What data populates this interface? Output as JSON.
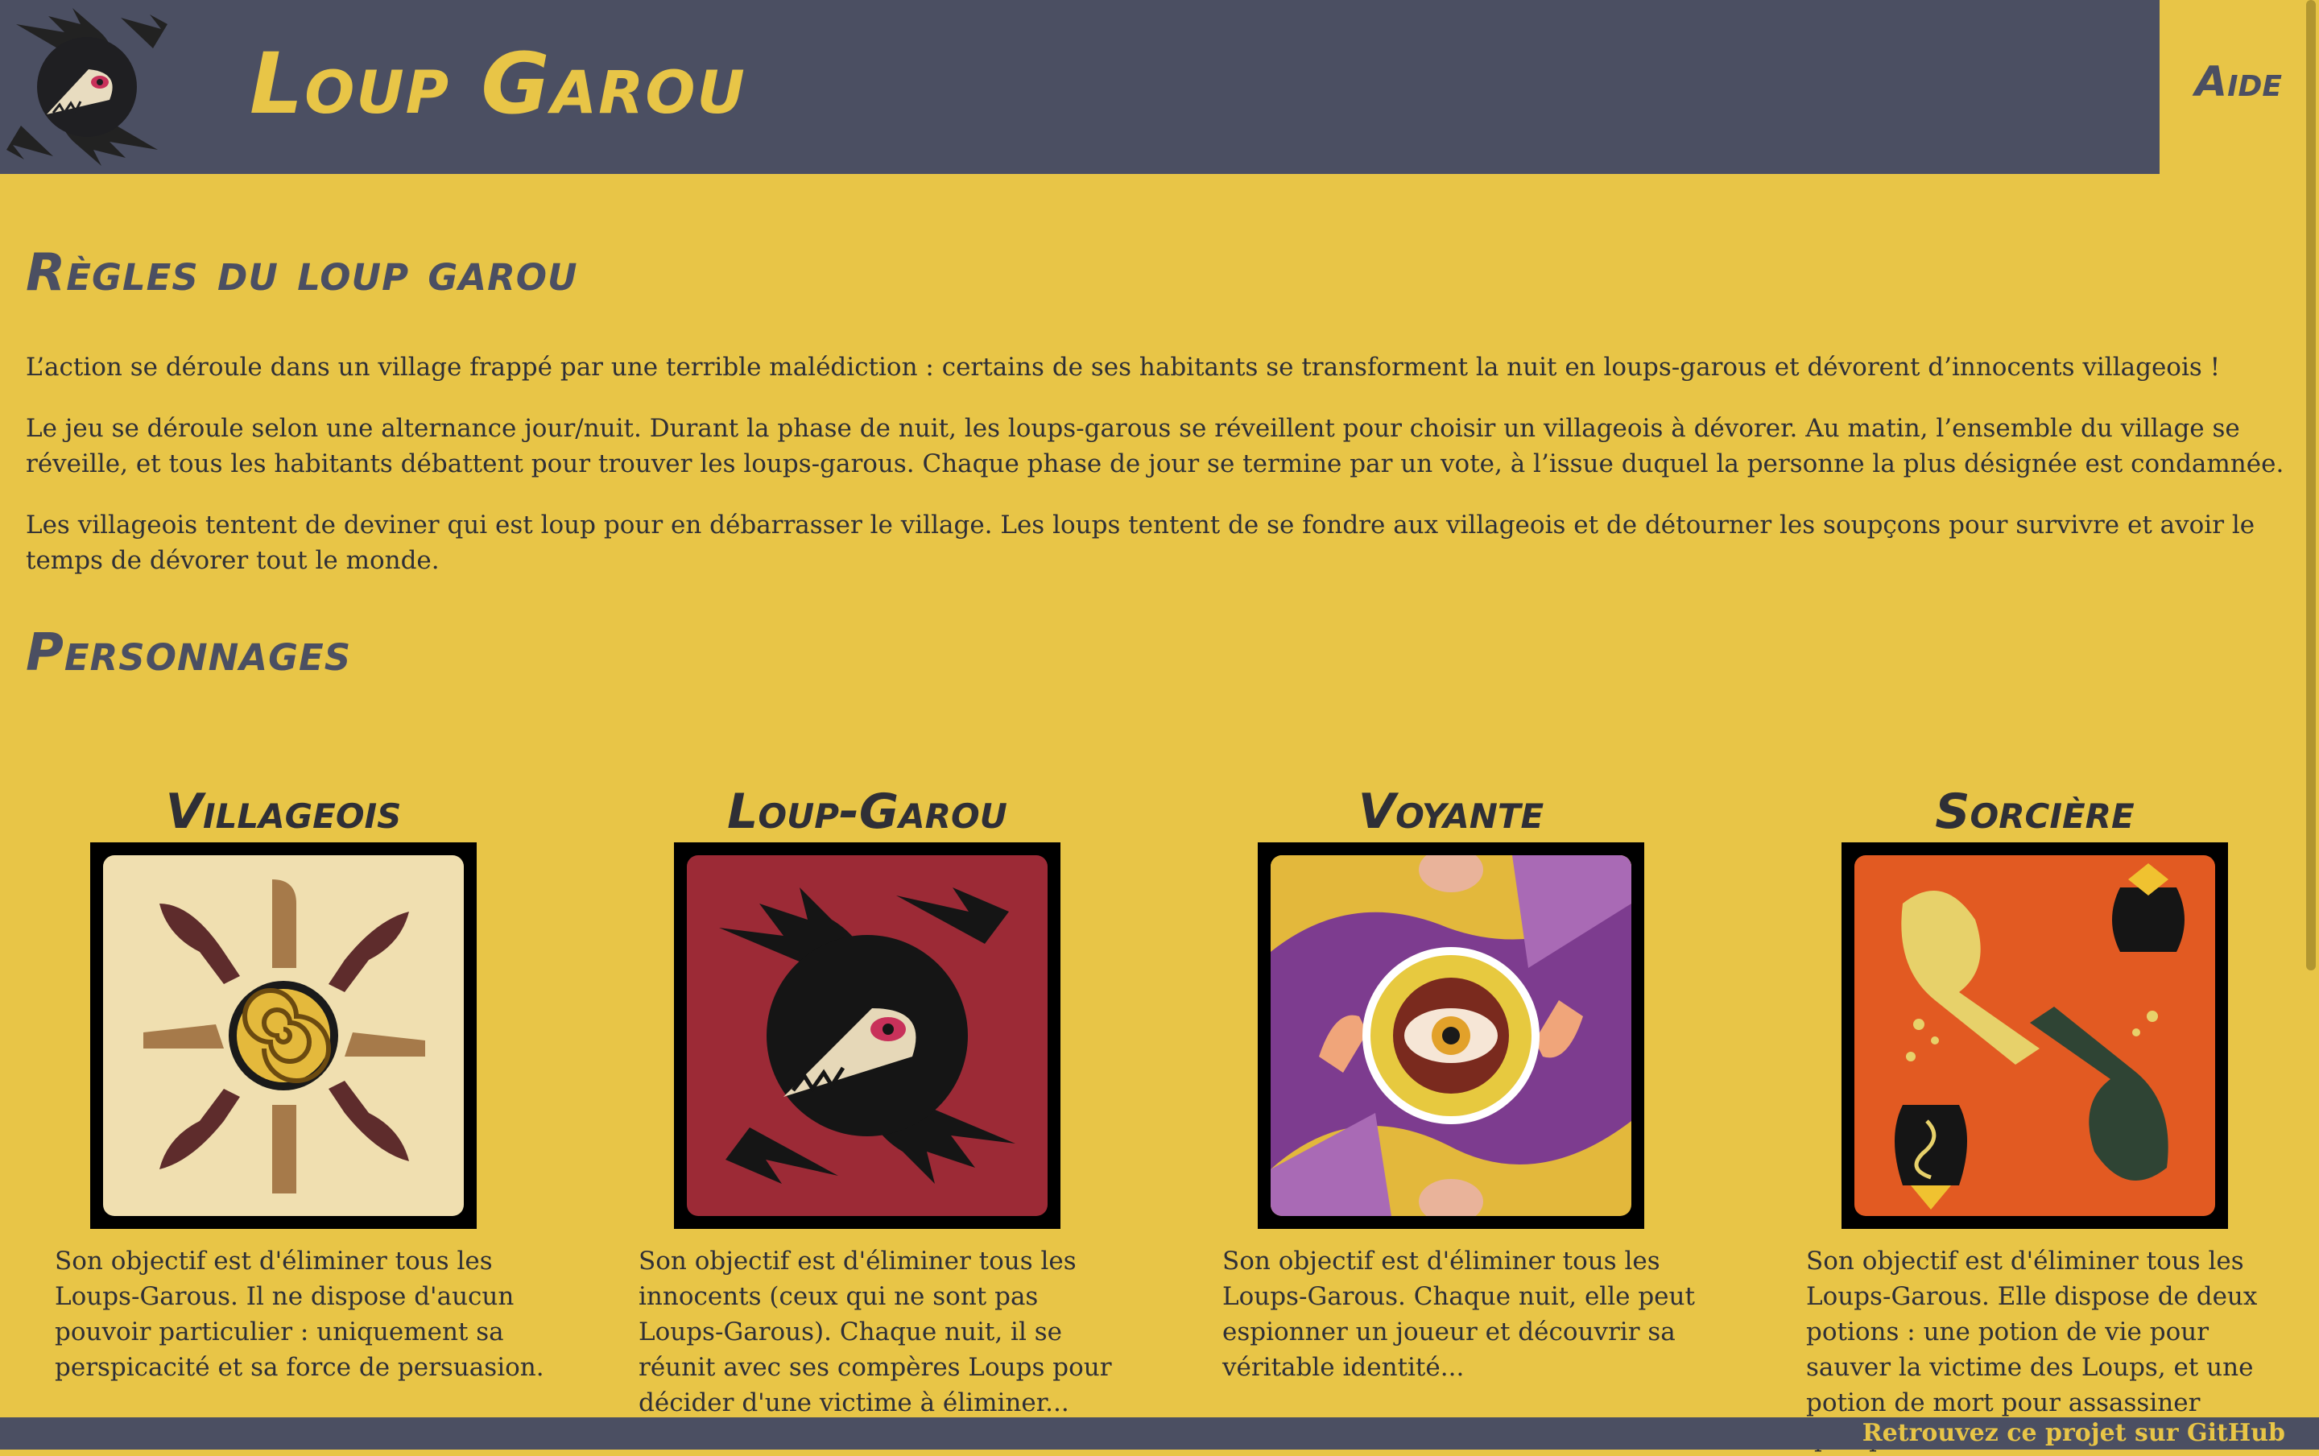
{
  "header": {
    "title": "Loup Garou",
    "help_label": "Aide"
  },
  "rules": {
    "title": "Règles du loup garou",
    "paragraphs": [
      "L’action se déroule dans un village frappé par une terrible malédiction : certains de ses habitants se transforment la nuit en loups-garous et dévorent d’innocents villageois !",
      "Le jeu se déroule selon une alternance jour/nuit. Durant la phase de nuit, les loups-garous se réveillent pour choisir un villageois à dévorer. Au matin, l’ensemble du village se réveille, et tous les habitants débattent pour trouver les loups-garous. Chaque phase de jour se termine par un vote, à l’issue duquel la personne la plus désignée est condamnée.",
      "Les villageois tentent de deviner qui est loup pour en débarrasser le village. Les loups tentent de se fondre aux villageois et de détourner les soupçons pour survivre et avoir le temps de dévorer tout le monde."
    ]
  },
  "characters": {
    "title": "Personnages",
    "items": [
      {
        "name": "Villageois",
        "description": "Son objectif est d'éliminer tous les Loups-Garous. Il ne dispose d'aucun pouvoir particulier : uniquement sa perspicacité et sa force de persuasion."
      },
      {
        "name": "Loup-Garou",
        "description": "Son objectif est d'éliminer tous les innocents (ceux qui ne sont pas Loups-Garous). Chaque nuit, il se réunit avec ses compères Loups pour décider d'une victime à éliminer..."
      },
      {
        "name": "Voyante",
        "description": "Son objectif est d'éliminer tous les Loups-Garous. Chaque nuit, elle peut espionner un joueur et découvrir sa véritable identité..."
      },
      {
        "name": "Sorcière",
        "description": "Son objectif est d'éliminer tous les Loups-Garous. Elle dispose de deux potions : une potion de vie pour sauver la victime des Loups, et une potion de mort pour assassiner quelqu'un."
      }
    ]
  },
  "footer": {
    "link_label": "Retrouvez ce projet sur GitHub"
  },
  "colors": {
    "background": "#e8c547",
    "header": "#4b4f62",
    "title": "#e8c547",
    "text": "#2f2f36"
  }
}
